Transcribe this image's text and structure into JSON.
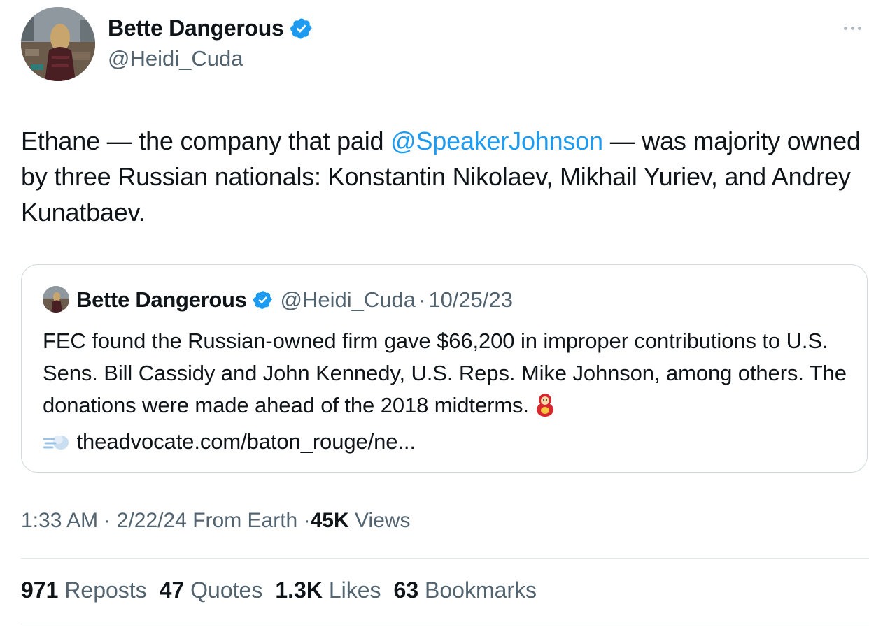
{
  "author": {
    "display_name": "Bette Dangerous",
    "handle": "@Heidi_Cuda"
  },
  "tweet": {
    "text_before_mention": "Ethane — the company that paid ",
    "mention": "@SpeakerJohnson",
    "text_after_mention": " — was majority owned by three Russian nationals: Konstantin Nikolaev, Mikhail Yuriev, and Andrey Kunatbaev."
  },
  "quoted_tweet": {
    "display_name": "Bette Dangerous",
    "handle": "@Heidi_Cuda",
    "separator": "·",
    "date": "10/25/23",
    "text": "FEC found the Russian-owned firm gave $66,200 in improper contributions to U.S. Sens. Bill Cassidy and John Kennedy, U.S. Reps. Mike Johnson, among others. The donations were made ahead of the 2018 midterms.",
    "link": "theadvocate.com/baton_rouge/ne..."
  },
  "meta": {
    "time": "1:33 AM",
    "separator": "·",
    "date": "2/22/24",
    "source": "From Earth",
    "views_count": "45K",
    "views_label": "Views"
  },
  "stats": [
    {
      "count": "971",
      "label": "Reposts"
    },
    {
      "count": "47",
      "label": "Quotes"
    },
    {
      "count": "1.3K",
      "label": "Likes"
    },
    {
      "count": "63",
      "label": "Bookmarks"
    }
  ],
  "colors": {
    "accent": "#1d9bf0",
    "text": "#0f1419",
    "secondary": "#536471",
    "border": "#cfd9de"
  }
}
